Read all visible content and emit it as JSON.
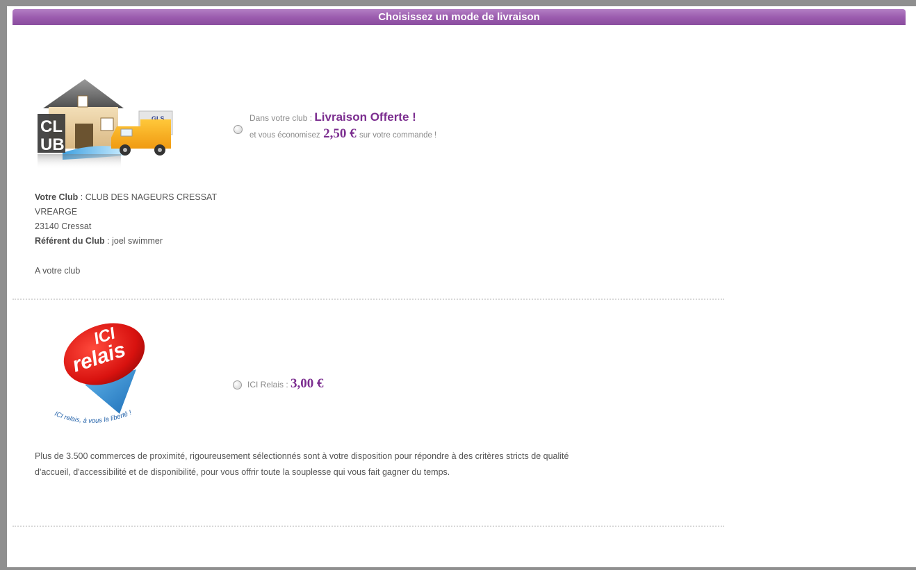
{
  "header": {
    "title": "Choisissez un mode de livraison"
  },
  "options": [
    {
      "club_label": "Dans votre club",
      "separator": " : ",
      "promo": "Livraison Offerte !",
      "savings_prefix": "et vous économisez",
      "savings_amount": "2,50 €",
      "savings_suffix": "sur votre commande !",
      "logo": {
        "icon": "club-house-delivery-icon",
        "van_text": "GLS",
        "letters_top": "CL",
        "letters_bottom": "UB"
      },
      "details": {
        "club_label": "Votre Club",
        "club_name": "CLUB DES NAGEURS CRESSAT",
        "address_line": "VREARGE",
        "city_line": "23140 Cressat",
        "referent_label": "Référent du Club",
        "referent_name": "joel swimmer",
        "note": "A votre club"
      }
    },
    {
      "label": "ICI Relais",
      "separator": " : ",
      "price": "3,00 €",
      "logo": {
        "icon": "ici-relais-logo-icon",
        "line1": "ICI",
        "line2": "relais",
        "tagline": "ICI relais, à vous la liberté !"
      },
      "description": "Plus de 3.500 commerces de proximité, rigoureusement sélectionnés sont à votre disposition pour répondre à des critères stricts de qualité d'accueil, d'accessibilité et de disponibilité, pour vous offrir toute la souplesse qui vous fait gagner du temps."
    }
  ],
  "colors": {
    "accent": "#8a4d9f",
    "price": "#7b2d8f",
    "text": "#555555"
  }
}
